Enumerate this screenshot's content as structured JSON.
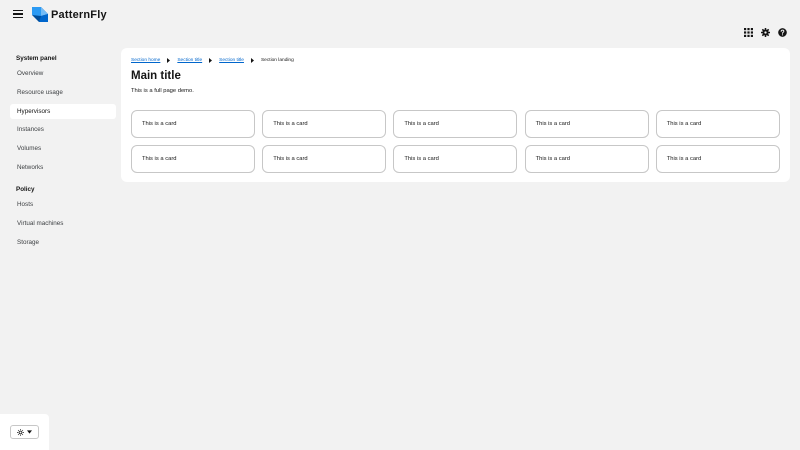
{
  "masthead": {
    "brand": "PatternFly",
    "icons": [
      "menu-icon",
      "apps-grid-icon",
      "settings-gear-icon",
      "help-icon"
    ]
  },
  "sidebar": {
    "groups": [
      {
        "title": "System panel",
        "items": [
          {
            "label": "Overview"
          },
          {
            "label": "Resource usage"
          },
          {
            "label": "Hypervisors",
            "current": true
          },
          {
            "label": "Instances"
          },
          {
            "label": "Volumes"
          },
          {
            "label": "Networks"
          }
        ]
      },
      {
        "title": "Policy",
        "items": [
          {
            "label": "Hosts"
          },
          {
            "label": "Virtual machines"
          },
          {
            "label": "Storage"
          }
        ]
      }
    ],
    "theme_toggle": {
      "icon": "sun-icon",
      "caret": "caret-down-icon"
    }
  },
  "main": {
    "breadcrumb": [
      "Section home",
      "Section title",
      "Section title",
      "Section landing"
    ],
    "title": "Main title",
    "description": "This is a full page demo.",
    "cards": [
      "This is a card",
      "This is a card",
      "This is a card",
      "This is a card",
      "This is a card",
      "This is a card",
      "This is a card",
      "This is a card",
      "This is a card",
      "This is a card"
    ]
  },
  "colors": {
    "page_bg": "#f2f2f2",
    "surface": "#ffffff",
    "link": "#0066cc",
    "logo_blue_dark": "#004d99",
    "logo_blue_light": "#73bcf7",
    "border": "#c7c7c7"
  }
}
